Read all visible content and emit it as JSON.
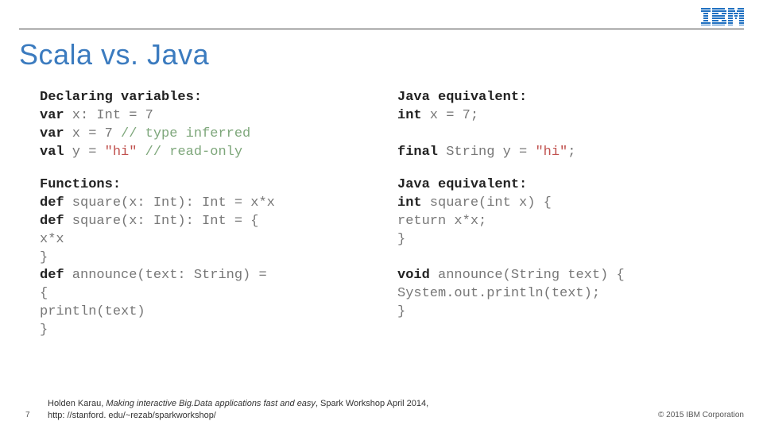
{
  "page_number": "7",
  "title": "Scala vs. Java",
  "left": {
    "declaring_header": "Declaring variables:",
    "l1a": "var",
    "l1b": " x: Int = 7",
    "l2a": "var",
    "l2b": " x = 7 ",
    "l2c": "// type inferred",
    "l3a": "val",
    "l3b": " y = ",
    "l3c": "\"hi\"",
    "l3d": " ",
    "l3e": "// read-only",
    "fn_header": "Functions:",
    "f1a": "def",
    "f1b": " square(x: Int): Int = x*x",
    "f2a": "def",
    "f2b": " square(x: Int): Int = {",
    "f3": "  x*x",
    "f4": "}",
    "f5a": "def",
    "f5b": " announce(text: String) =",
    "f6": "{",
    "f7": "  println(text)",
    "f8": "}"
  },
  "right": {
    "je1": "Java equivalent:",
    "r1a": "int",
    "r1b": " x = 7;",
    "rblank": " ",
    "r2a": "final",
    "r2b": " String y = ",
    "r2c": "\"hi\"",
    "r2d": ";",
    "je2": "Java equivalent:",
    "r3a": "int",
    "r3b": " square(int x) {",
    "r4": "  return x*x;",
    "r5": "}",
    "r6a": "void",
    "r6b": " announce(String text) {",
    "r7": "  System.out.println(text);",
    "r8": "}"
  },
  "citation": {
    "author": "Holden Karau, ",
    "title_ital": "Making interactive Big.Data applications fast and easy",
    "rest": ", Spark Workshop April 2014,",
    "url": "http: //stanford. edu/~rezab/sparkworkshop/"
  },
  "copyright": "© 2015 IBM Corporation"
}
